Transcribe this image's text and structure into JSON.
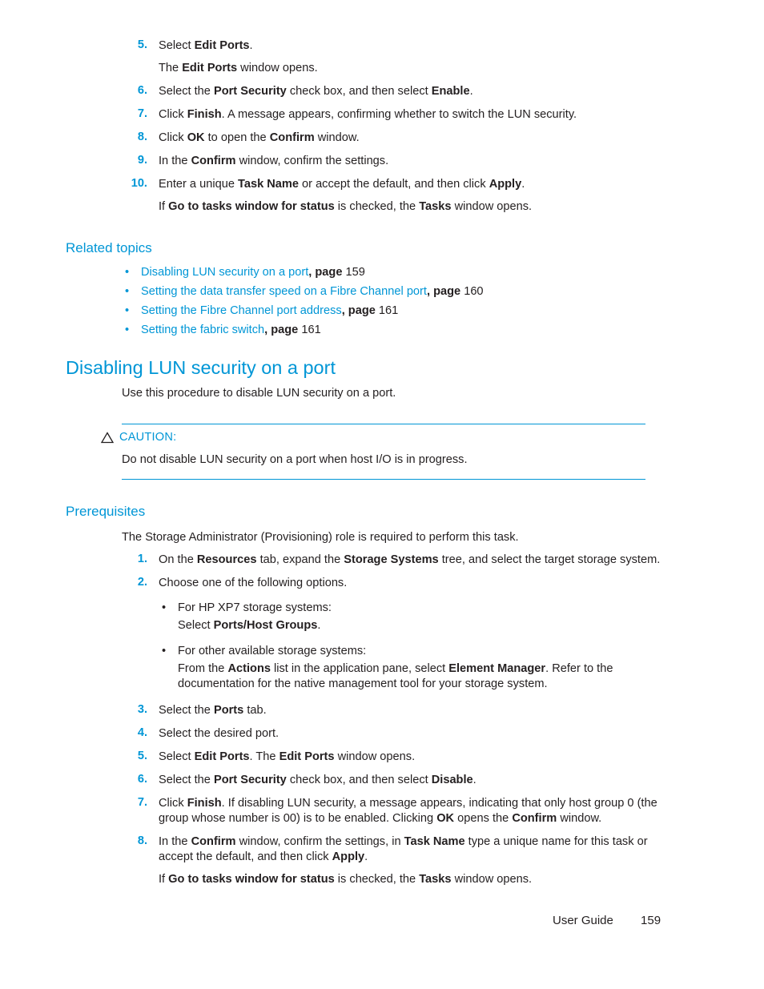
{
  "document": {
    "footer": {
      "label": "User Guide",
      "page_number": "159"
    },
    "colors": {
      "accent_blue": "#0096D6",
      "body_text": "#231F20"
    }
  },
  "top_procedure": {
    "items": [
      {
        "num": "5.",
        "parts": [
          {
            "t": "Select ",
            "b": false
          },
          {
            "t": "Edit Ports",
            "b": true
          },
          {
            "t": ".",
            "b": false
          }
        ],
        "sub_parts": [
          {
            "t": "The ",
            "b": false
          },
          {
            "t": "Edit Ports",
            "b": true
          },
          {
            "t": " window opens.",
            "b": false
          }
        ]
      },
      {
        "num": "6.",
        "parts": [
          {
            "t": "Select the ",
            "b": false
          },
          {
            "t": "Port Security",
            "b": true
          },
          {
            "t": " check box, and then select ",
            "b": false
          },
          {
            "t": "Enable",
            "b": true
          },
          {
            "t": ".",
            "b": false
          }
        ]
      },
      {
        "num": "7.",
        "parts": [
          {
            "t": "Click ",
            "b": false
          },
          {
            "t": "Finish",
            "b": true
          },
          {
            "t": ". A message appears, confirming whether to switch the LUN security.",
            "b": false
          }
        ]
      },
      {
        "num": "8.",
        "parts": [
          {
            "t": "Click ",
            "b": false
          },
          {
            "t": "OK",
            "b": true
          },
          {
            "t": " to open the ",
            "b": false
          },
          {
            "t": "Confirm",
            "b": true
          },
          {
            "t": " window.",
            "b": false
          }
        ]
      },
      {
        "num": "9.",
        "parts": [
          {
            "t": "In the ",
            "b": false
          },
          {
            "t": "Confirm",
            "b": true
          },
          {
            "t": " window, confirm the settings.",
            "b": false
          }
        ]
      },
      {
        "num": "10.",
        "parts": [
          {
            "t": "Enter a unique ",
            "b": false
          },
          {
            "t": "Task Name",
            "b": true
          },
          {
            "t": " or accept the default, and then click ",
            "b": false
          },
          {
            "t": "Apply",
            "b": true
          },
          {
            "t": ".",
            "b": false
          }
        ],
        "sub_parts": [
          {
            "t": "If ",
            "b": false
          },
          {
            "t": "Go to tasks window for status",
            "b": true
          },
          {
            "t": " is checked, the ",
            "b": false
          },
          {
            "t": "Tasks",
            "b": true
          },
          {
            "t": " window opens.",
            "b": false
          }
        ]
      }
    ]
  },
  "related_topics": {
    "heading": "Related topics",
    "items": [
      {
        "link": "Disabling LUN security on a port",
        "page_label": ", page ",
        "page": "159"
      },
      {
        "link": "Setting the data transfer speed on a Fibre Channel port",
        "page_label": ", page ",
        "page": "160"
      },
      {
        "link": "Setting the Fibre Channel port address",
        "page_label": ", page ",
        "page": "161"
      },
      {
        "link": "Setting the fabric switch",
        "page_label": ", page ",
        "page": "161"
      }
    ]
  },
  "section": {
    "heading": "Disabling LUN security on a port",
    "intro": "Use this procedure to disable LUN security on a port."
  },
  "caution": {
    "icon": "caution-triangle-icon",
    "label": "CAUTION:",
    "body": "Do not disable LUN security on a port when host I/O is in progress."
  },
  "prerequisites": {
    "heading": "Prerequisites",
    "intro": "The Storage Administrator (Provisioning) role is required to perform this task.",
    "items": [
      {
        "num": "1.",
        "parts": [
          {
            "t": "On the ",
            "b": false
          },
          {
            "t": "Resources",
            "b": true
          },
          {
            "t": " tab, expand the ",
            "b": false
          },
          {
            "t": "Storage Systems",
            "b": true
          },
          {
            "t": " tree, and select the target storage system.",
            "b": false
          }
        ]
      },
      {
        "num": "2.",
        "parts": [
          {
            "t": "Choose one of the following options.",
            "b": false
          }
        ],
        "bullets": [
          {
            "line1": [
              {
                "t": "For HP XP7 storage systems:",
                "b": false
              }
            ],
            "line2": [
              {
                "t": "Select ",
                "b": false
              },
              {
                "t": "Ports/Host Groups",
                "b": true
              },
              {
                "t": ".",
                "b": false
              }
            ]
          },
          {
            "line1": [
              {
                "t": "For other available storage systems:",
                "b": false
              }
            ],
            "line2": [
              {
                "t": "From the ",
                "b": false
              },
              {
                "t": "Actions",
                "b": true
              },
              {
                "t": " list in the application pane, select ",
                "b": false
              },
              {
                "t": "Element Manager",
                "b": true
              },
              {
                "t": ". Refer to the documentation for the native management tool for your storage system.",
                "b": false
              }
            ]
          }
        ]
      },
      {
        "num": "3.",
        "parts": [
          {
            "t": "Select the ",
            "b": false
          },
          {
            "t": "Ports",
            "b": true
          },
          {
            "t": " tab.",
            "b": false
          }
        ]
      },
      {
        "num": "4.",
        "parts": [
          {
            "t": "Select the desired port.",
            "b": false
          }
        ]
      },
      {
        "num": "5.",
        "parts": [
          {
            "t": "Select ",
            "b": false
          },
          {
            "t": "Edit Ports",
            "b": true
          },
          {
            "t": ". The ",
            "b": false
          },
          {
            "t": "Edit Ports",
            "b": true
          },
          {
            "t": " window opens.",
            "b": false
          }
        ]
      },
      {
        "num": "6.",
        "parts": [
          {
            "t": "Select the ",
            "b": false
          },
          {
            "t": "Port Security",
            "b": true
          },
          {
            "t": " check box, and then select ",
            "b": false
          },
          {
            "t": "Disable",
            "b": true
          },
          {
            "t": ".",
            "b": false
          }
        ]
      },
      {
        "num": "7.",
        "parts": [
          {
            "t": "Click ",
            "b": false
          },
          {
            "t": "Finish",
            "b": true
          },
          {
            "t": ". If disabling LUN security, a message appears, indicating that only host group 0 (the group whose number is 00) is to be enabled. Clicking ",
            "b": false
          },
          {
            "t": "OK",
            "b": true
          },
          {
            "t": " opens the ",
            "b": false
          },
          {
            "t": "Confirm",
            "b": true
          },
          {
            "t": " window.",
            "b": false
          }
        ]
      },
      {
        "num": "8.",
        "parts": [
          {
            "t": "In the ",
            "b": false
          },
          {
            "t": "Confirm",
            "b": true
          },
          {
            "t": " window, confirm the settings, in ",
            "b": false
          },
          {
            "t": "Task Name",
            "b": true
          },
          {
            "t": " type a unique name for this task or accept the default, and then click ",
            "b": false
          },
          {
            "t": "Apply",
            "b": true
          },
          {
            "t": ".",
            "b": false
          }
        ],
        "sub_parts": [
          {
            "t": "If ",
            "b": false
          },
          {
            "t": "Go to tasks window for status",
            "b": true
          },
          {
            "t": " is checked, the ",
            "b": false
          },
          {
            "t": "Tasks",
            "b": true
          },
          {
            "t": " window opens.",
            "b": false
          }
        ]
      }
    ]
  }
}
